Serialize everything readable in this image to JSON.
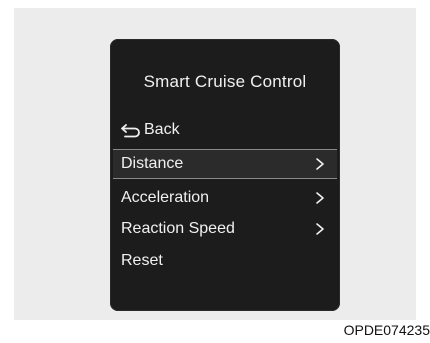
{
  "display": {
    "title": "Smart Cruise Control",
    "back": {
      "label": "Back",
      "icon": "return-arrow-icon"
    },
    "menu": {
      "items": [
        {
          "label": "Distance",
          "has_submenu": true,
          "selected": true
        },
        {
          "label": "Acceleration",
          "has_submenu": true,
          "selected": false
        },
        {
          "label": "Reaction Speed",
          "has_submenu": true,
          "selected": false
        },
        {
          "label": "Reset",
          "has_submenu": false,
          "selected": false
        }
      ]
    }
  },
  "figure_code": "OPDE074235",
  "colors": {
    "display_background": "#1c1c1c",
    "text": "#f0f0f0",
    "frame_background": "#ececec",
    "selection_border": "#8a8a8a"
  }
}
